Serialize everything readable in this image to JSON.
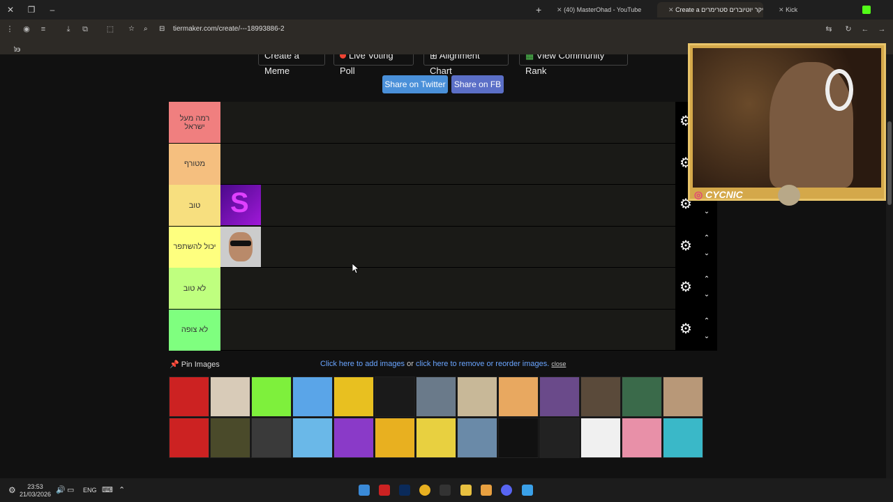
{
  "browser": {
    "tabs": [
      {
        "label": "Kick",
        "active": false
      },
      {
        "label": "Create a טירמייקר יוטיוברים סטרימרים",
        "active": true
      },
      {
        "label": "(40) MasterOhad - YouTube",
        "active": false
      }
    ],
    "new_tab": "+",
    "url": "tiermaker.com/create/---18993886-2",
    "bookmarks_label": "כל הסימניות"
  },
  "page": {
    "top_buttons": [
      "Create a Meme",
      "Live Voting Poll",
      "Alignment Chart",
      "View Community Rank"
    ],
    "share_twitter": "Share on Twitter",
    "share_fb": "Share on FB",
    "tiers": [
      {
        "label": "רמה מעל ישראל",
        "color": "#f07f7f"
      },
      {
        "label": "מטורף",
        "color": "#f5bf7f"
      },
      {
        "label": "טוב",
        "color": "#f7df7f"
      },
      {
        "label": "יכול להשתפר",
        "color": "#feff7f"
      },
      {
        "label": "לא טוב",
        "color": "#bfff7f"
      },
      {
        "label": "לא צופה",
        "color": "#7fff7f"
      }
    ],
    "pin_images": "Pin Images",
    "add_images_link": "Click here to add images",
    "or_text": " or ",
    "reorder_link": "click here to remove or reorder images.",
    "close_link": "close"
  },
  "webcam": {
    "tag": "CYCNIC"
  },
  "taskbar": {
    "time": "23:53",
    "date": "21/03/2026",
    "lang": "ENG"
  },
  "colors": {
    "twitter": "#4a90d9",
    "fb": "#5b6fc7",
    "link": "#6aa5ff"
  }
}
